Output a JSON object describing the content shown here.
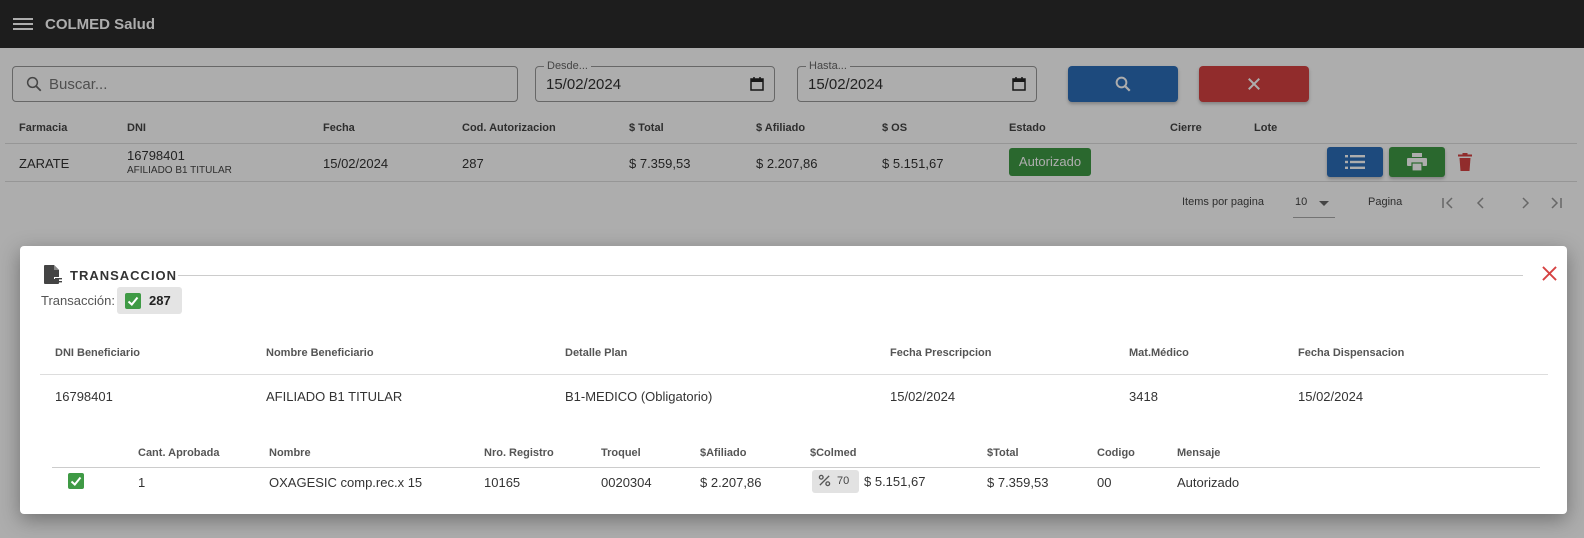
{
  "app": {
    "title": "COLMED Salud"
  },
  "search": {
    "placeholder": "Buscar...",
    "desde_label": "Desde...",
    "desde_value": "15/02/2024",
    "hasta_label": "Hasta...",
    "hasta_value": "15/02/2024"
  },
  "table": {
    "headers": [
      "Farmacia",
      "DNI",
      "Fecha",
      "Cod. Autorizacion",
      "$ Total",
      "$ Afiliado",
      "$ OS",
      "Estado",
      "Cierre",
      "Lote"
    ],
    "row": {
      "farmacia": "ZARATE",
      "dni": "16798401",
      "afiliado": "AFILIADO B1 TITULAR",
      "fecha": "15/02/2024",
      "cod": "287",
      "total": "$ 7.359,53",
      "afiliado_monto": "$ 2.207,86",
      "os": "$ 5.151,67",
      "estado": "Autorizado"
    }
  },
  "paginator": {
    "items_label": "Items por pagina",
    "page_size": "10",
    "page_label": "Pagina"
  },
  "dialog": {
    "title": "TRANSACCION",
    "tx_label": "Transacción:",
    "tx_number": "287",
    "headers": [
      "DNI Beneficiario",
      "Nombre Beneficiario",
      "Detalle Plan",
      "Fecha Prescripcion",
      "Mat.Médico",
      "Fecha Dispensacion"
    ],
    "values": [
      "16798401",
      "AFILIADO B1 TITULAR",
      "B1-MEDICO (Obligatorio)",
      "15/02/2024",
      "3418",
      "15/02/2024"
    ],
    "item_headers": [
      "Cant. Aprobada",
      "Nombre",
      "Nro. Registro",
      "Troquel",
      "$Afiliado",
      "$Colmed",
      "$Total",
      "Codigo",
      "Mensaje"
    ],
    "item": {
      "cant": "1",
      "nombre": "OXAGESIC comp.rec.x 15",
      "registro": "10165",
      "troquel": "0020304",
      "afiliado": "$ 2.207,86",
      "pct": "70",
      "colmed": "$ 5.151,67",
      "total": "$ 7.359,53",
      "codigo": "00",
      "mensaje": "Autorizado"
    }
  },
  "colors": {
    "topbar": "#2b2b2b",
    "primary": "#2c6db8",
    "danger": "#d64242",
    "success": "#3f9a45"
  }
}
